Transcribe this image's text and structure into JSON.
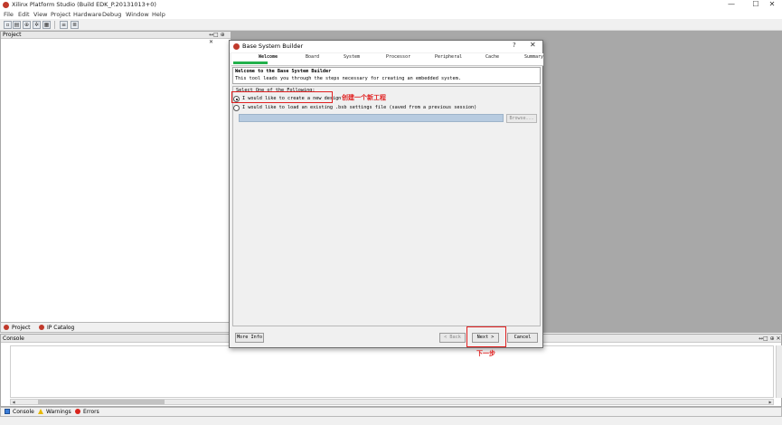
{
  "app": {
    "title": "Xilinx Platform Studio (Build EDK_P.20131013+0)",
    "minimize": "—",
    "maximize": "☐",
    "close": "✕"
  },
  "menu": [
    "File",
    "Edit",
    "View",
    "Project",
    "Hardware",
    "Debug",
    "Window",
    "Help"
  ],
  "project_panel": {
    "title": "Project",
    "controls": "↔□ ⊕ ✕",
    "tabs": [
      "Project",
      "IP Catalog"
    ]
  },
  "console": {
    "title": "Console",
    "controls": "↔□ ⊕ ✕",
    "tabs": [
      "Console",
      "Warnings",
      "Errors"
    ]
  },
  "dialog": {
    "title": "Base System Builder",
    "help": "?",
    "close": "✕",
    "steps": [
      "Welcome",
      "Board",
      "System",
      "Processor",
      "Peripheral",
      "Cache",
      "Summary"
    ],
    "active_step": "Welcome",
    "welcome_title": "Welcome to the Base System Builder",
    "welcome_text": "This tool leads you through the steps necessary for creating an embedded system.",
    "group_label": "Select One of the Following:",
    "option_new": "I would like to create a new design",
    "option_load": "I would like to load an existing .bsb settings file (saved from a previous session)",
    "browse": "Browse...",
    "more_info": "More Info",
    "back": "< Back",
    "next": "Next >",
    "cancel": "Cancel"
  },
  "annotations": {
    "create_project": "创建一个新工程",
    "next_step": "下一步"
  },
  "colors": {
    "highlight": "#e02020",
    "progress": "#22b14c",
    "workspace": "#a8a8a8"
  }
}
